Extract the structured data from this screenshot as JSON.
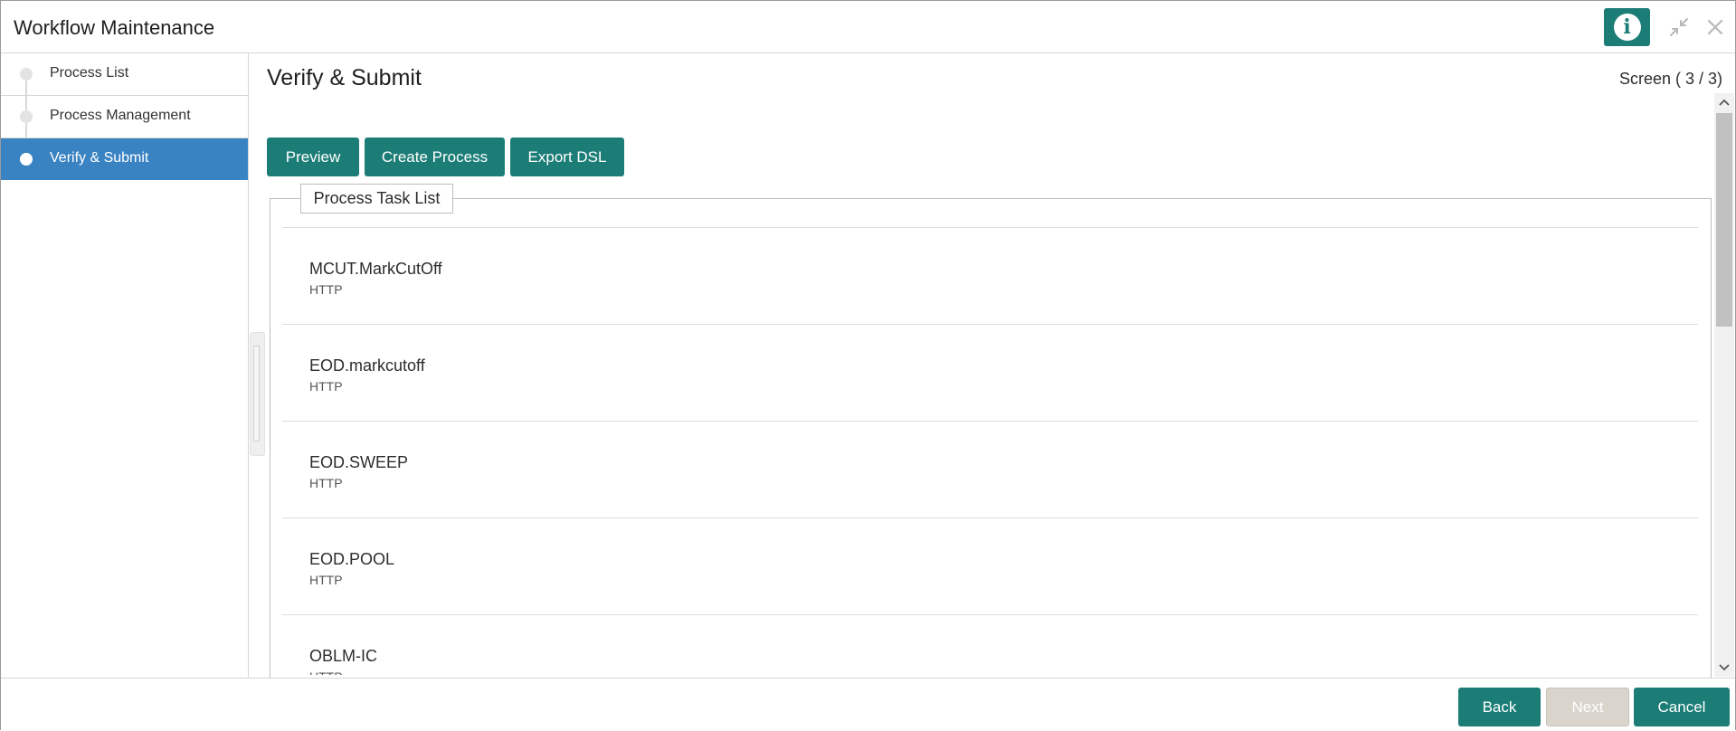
{
  "header": {
    "title": "Workflow Maintenance",
    "info_icon_glyph": "i",
    "icons": [
      "info-icon",
      "minimize-icon",
      "close-icon"
    ]
  },
  "sidebar": {
    "steps": [
      {
        "label": "Process List",
        "active": false
      },
      {
        "label": "Process Management",
        "active": false
      },
      {
        "label": "Verify & Submit",
        "active": true
      }
    ]
  },
  "main": {
    "title": "Verify & Submit",
    "screen_indicator": "Screen ( 3 / 3)",
    "buttons": [
      "Preview",
      "Create Process",
      "Export DSL"
    ],
    "section_legend": "Process Task List",
    "tasks": [
      {
        "name": "MCUT.MarkCutOff",
        "type": "HTTP"
      },
      {
        "name": "EOD.markcutoff",
        "type": "HTTP"
      },
      {
        "name": "EOD.SWEEP",
        "type": "HTTP"
      },
      {
        "name": "EOD.POOL",
        "type": "HTTP"
      },
      {
        "name": "OBLM-IC",
        "type": "HTTP"
      }
    ]
  },
  "footer": {
    "back_label": "Back",
    "next_label": "Next",
    "cancel_label": "Cancel"
  },
  "colors": {
    "primary": "#1c7d77",
    "active_step": "#3a83c3",
    "disabled": "#d9d4cc"
  }
}
